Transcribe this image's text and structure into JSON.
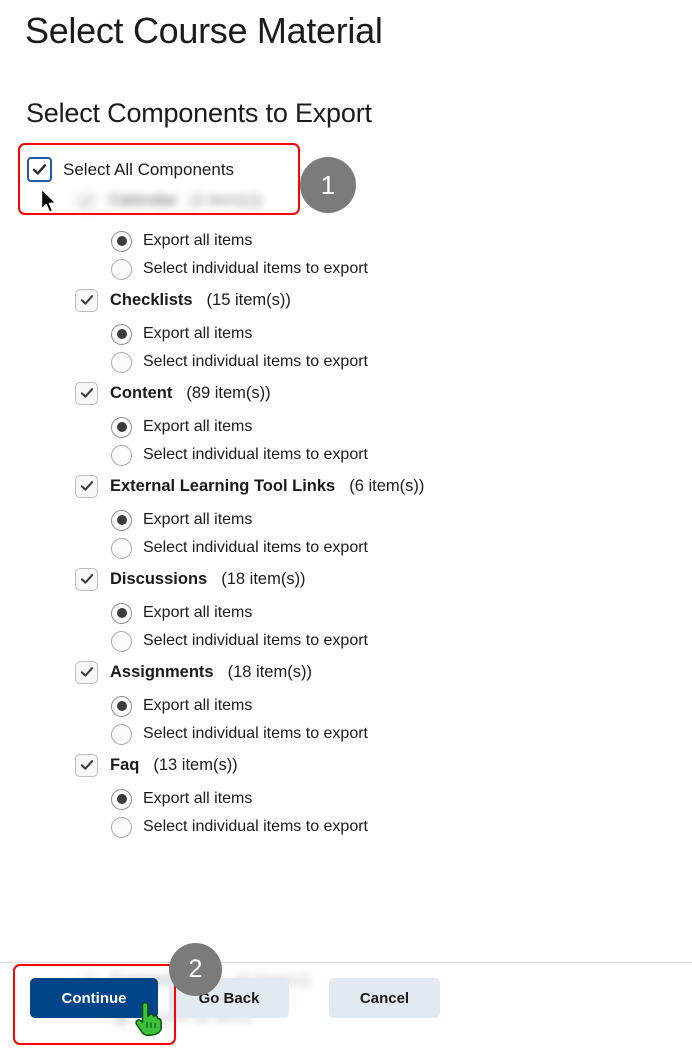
{
  "page": {
    "title": "Select Course Material",
    "section_title": "Select Components to Export"
  },
  "select_all": {
    "label": "Select All Components",
    "checked": true,
    "checkbox_icon": "checkmark-icon",
    "focus_ring_color": "#1f5aa8"
  },
  "obscured_component": {
    "name": "Calendar",
    "count": "(3 item(s))",
    "checked": true,
    "note": "blurred behind annotation box"
  },
  "radio_options": {
    "export_all": "Export all items",
    "select_individual": "Select individual items to export",
    "selected": "export_all"
  },
  "components": [
    {
      "name": "Checklists",
      "count": "(15 item(s))",
      "checked": true
    },
    {
      "name": "Content",
      "count": "(89 item(s))",
      "checked": true
    },
    {
      "name": "External Learning Tool Links",
      "count": "(6 item(s))",
      "checked": true
    },
    {
      "name": "Discussions",
      "count": "(18 item(s))",
      "checked": true
    },
    {
      "name": "Assignments",
      "count": "(18 item(s))",
      "checked": true
    },
    {
      "name": "Faq",
      "count": "(13 item(s))",
      "checked": true
    }
  ],
  "footer_obscured": {
    "name": "Competencies",
    "count": "(4 item(s))",
    "radio_label": "Export all items",
    "note": "blurred content visible behind sticky footer"
  },
  "footer": {
    "continue_label": "Continue",
    "go_back_label": "Go Back",
    "cancel_label": "Cancel",
    "continue_color": "#004489",
    "secondary_color": "#e2e9f1"
  },
  "annotations": {
    "badge_1": "1",
    "badge_2": "2",
    "highlight_color": "#ff0000",
    "badge_color": "#7b7b7b"
  },
  "cursors": {
    "arrow": "arrow-cursor",
    "hand": "pointing-hand-cursor"
  }
}
